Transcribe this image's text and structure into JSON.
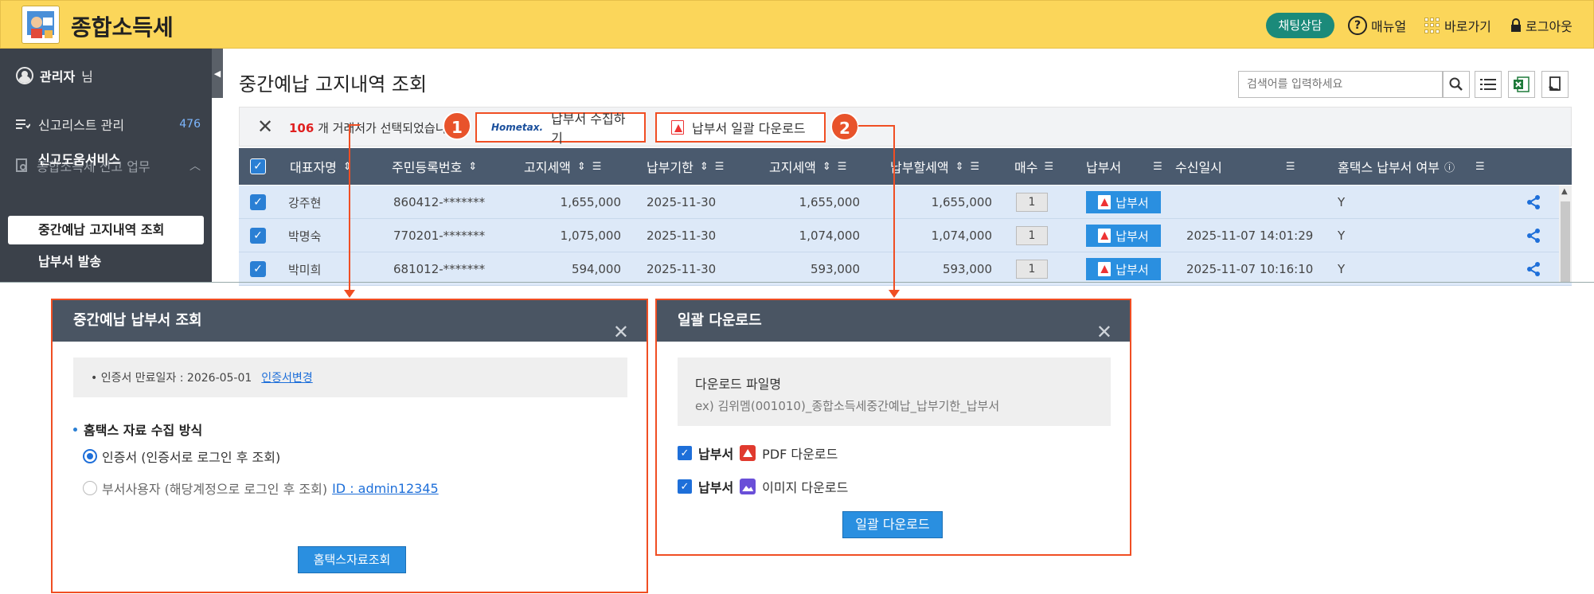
{
  "header": {
    "app_title": "종합소득세",
    "chat_label": "채팅상담",
    "manual_label": "매뉴얼",
    "shortcut_label": "바로가기",
    "logout_label": "로그아웃"
  },
  "sidebar": {
    "admin_name": "관리자",
    "admin_suffix": "님",
    "list_label": "신고리스트 관리",
    "list_count": "476",
    "group_label": "종합소득세 신고 업무",
    "sub_items": [
      "신고도움서비스",
      "중간예납 고지내역 조회",
      "납부서 발송"
    ]
  },
  "main": {
    "title": "중간예납 고지내역 조회",
    "search_placeholder": "검색어를 입력하세요",
    "selection_count": "106",
    "selection_text": "개 거래처가 선택되었습니다.",
    "collect_button": "납부서 수집하기",
    "collect_logo": "Hometax.",
    "bulk_download_button": "납부서 일괄 다운로드",
    "badge_1": "1",
    "badge_2": "2"
  },
  "table": {
    "columns": [
      "대표자명",
      "주민등록번호",
      "고지세액",
      "납부기한",
      "고지세액",
      "납부할세액",
      "매수",
      "납부서",
      "수신일시",
      "홈택스 납부서 여부"
    ],
    "rows": [
      {
        "name": "강주현",
        "rrn": "860412-*******",
        "notice_tax": "1,655,000",
        "due": "2025-11-30",
        "notice_tax2": "1,655,000",
        "pay_tax": "1,655,000",
        "count": "1",
        "bill": "납부서",
        "received": "",
        "hometax": "Y"
      },
      {
        "name": "박명숙",
        "rrn": "770201-*******",
        "notice_tax": "1,075,000",
        "due": "2025-11-30",
        "notice_tax2": "1,074,000",
        "pay_tax": "1,074,000",
        "count": "1",
        "bill": "납부서",
        "received": "2025-11-07 14:01:29",
        "hometax": "Y"
      },
      {
        "name": "박미희",
        "rrn": "681012-*******",
        "notice_tax": "594,000",
        "due": "2025-11-30",
        "notice_tax2": "593,000",
        "pay_tax": "593,000",
        "count": "1",
        "bill": "납부서",
        "received": "2025-11-07 10:16:10",
        "hometax": "Y"
      }
    ]
  },
  "modal_collect": {
    "title": "중간예납 납부서 조회",
    "cert_expiry": "• 인증서 만료일자 : 2026-05-01",
    "cert_change_link": "인증서변경",
    "section_title": "홈택스 자료 수집 방식",
    "option_cert": "인증서 (인증서로 로그인 후 조회)",
    "option_dept": "부서사용자 (해당계정으로 로그인 후 조회)",
    "dept_id_link": "ID : admin12345",
    "submit_button": "홈택스자료조회"
  },
  "modal_download": {
    "title": "일괄 다운로드",
    "filename_label": "다운로드 파일명",
    "filename_example": "ex) 김위멤(001010)_종합소득세중간예납_납부기한_납부서",
    "opt1_label": "납부서",
    "opt1_type": "PDF 다운로드",
    "opt2_label": "납부서",
    "opt2_type": "이미지 다운로드",
    "submit_button": "일괄 다운로드"
  },
  "colors": {
    "header_bg": "#fbd65a",
    "sidebar_bg": "#3b414a",
    "table_head": "#4a5a6e",
    "row_bg": "#dde9f8",
    "accent_orange": "#f04e23",
    "primary_blue": "#2a8fe0",
    "chat_green": "#1b8a7a"
  }
}
